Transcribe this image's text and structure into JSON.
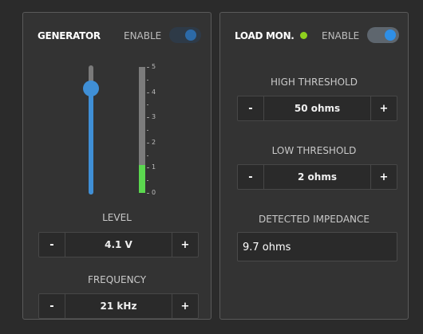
{
  "generator": {
    "title": "GENERATOR",
    "enable_label": "ENABLE",
    "enabled": false,
    "level_slider_fraction": 0.82,
    "meter": {
      "ticks": [
        "5",
        "4",
        "3",
        "2",
        "1",
        "0"
      ],
      "value": 1.1,
      "max": 5
    },
    "level_label": "LEVEL",
    "level_value": "4.1 V",
    "frequency_label": "FREQUENCY",
    "frequency_value": "21 kHz"
  },
  "load_monitor": {
    "title": "LOAD MON.",
    "enable_label": "ENABLE",
    "enabled": true,
    "status_color": "#8fd11e",
    "high_threshold_label": "HIGH THRESHOLD",
    "high_threshold_value": "50 ohms",
    "low_threshold_label": "LOW THRESHOLD",
    "low_threshold_value": "2 ohms",
    "detected_label": "DETECTED IMPEDANCE",
    "detected_value": "9.7 ohms"
  },
  "stepper": {
    "minus": "-",
    "plus": "+"
  },
  "colors": {
    "accent": "#3f8fd6",
    "meter_fill": "#5bd84f"
  }
}
